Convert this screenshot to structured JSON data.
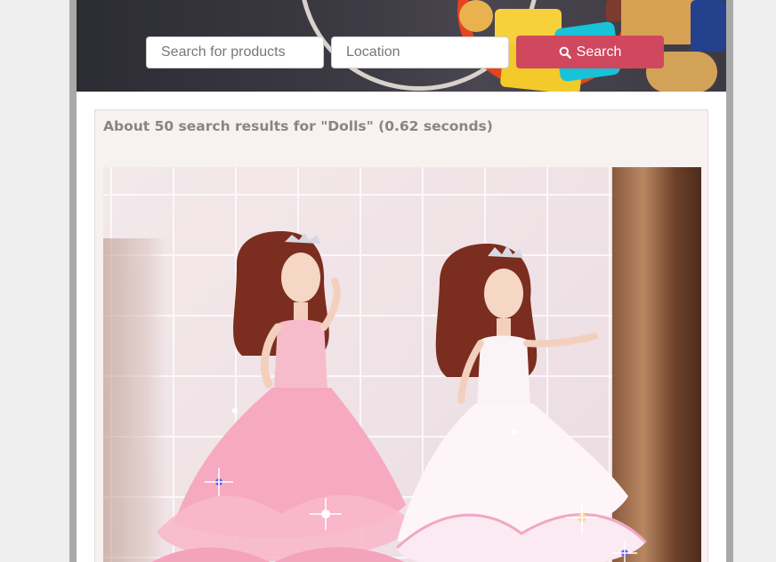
{
  "search": {
    "products_placeholder": "Search for products",
    "location_placeholder": "Location",
    "button_label": "Search"
  },
  "results": {
    "summary": "About 50 search results for \"Dolls\" (0.62 seconds)"
  },
  "colors": {
    "accent": "#d0485e",
    "summary_text": "#8a8482",
    "results_background": "#f7f1f0"
  },
  "icons": {
    "search_button_icon": "search-icon"
  }
}
